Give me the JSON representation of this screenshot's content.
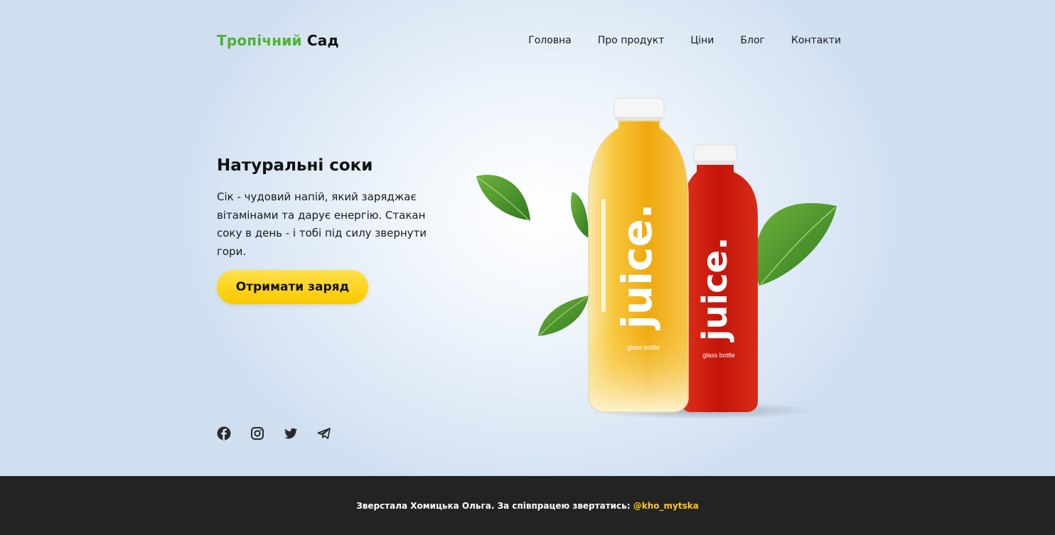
{
  "header": {
    "logo_part1": "Тропічний",
    "logo_part2": "Сад",
    "nav": [
      "Головна",
      "Про продукт",
      "Ціни",
      "Блог",
      "Контакти"
    ]
  },
  "hero": {
    "title": "Натуральні соки",
    "text": "Сік - чудовий напій, який заряджає вітамінами та дарує енергію. Стакан соку в день - і тобі під силу звернути гори.",
    "cta_label": "Отримати заряд"
  },
  "product": {
    "bottle_label": "juice.",
    "bottle_sublabel": "glass bottle"
  },
  "socials": [
    "facebook-icon",
    "instagram-icon",
    "twitter-icon",
    "telegram-icon"
  ],
  "footer": {
    "text": "Зверстала Хомицька Ольга. За співпрацею звертатись: ",
    "handle": "@kho_mytska"
  },
  "colors": {
    "brand_green": "#4fb233",
    "cta_yellow": "#ffd21a",
    "footer_bg": "#232323",
    "footer_link": "#ffc81a"
  }
}
